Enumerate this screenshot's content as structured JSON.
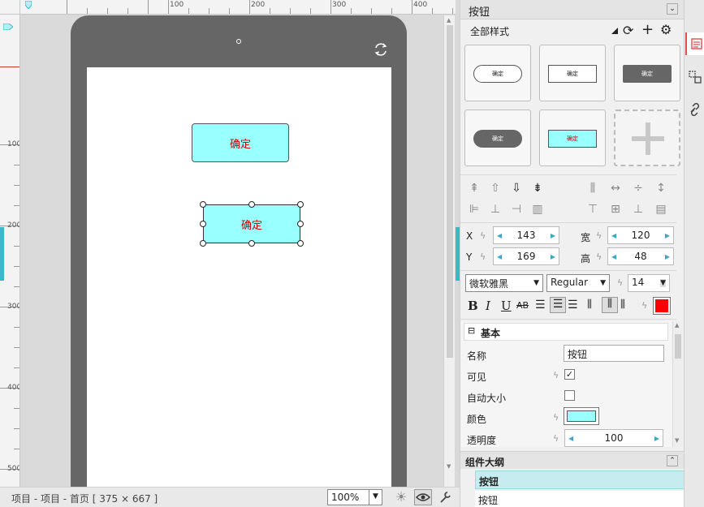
{
  "rulers": {
    "top_labels": [
      "100",
      "200",
      "300",
      "400"
    ],
    "left_labels": [
      "100",
      "200",
      "300",
      "400",
      "500"
    ]
  },
  "canvas": {
    "button1_label": "确定",
    "button2_label": "确定"
  },
  "status": {
    "breadcrumb": "项目 - 项目 - 首页 [ 375 × 667 ]",
    "zoom": "100%"
  },
  "panel": {
    "title": "按钮",
    "styles_filter": "全部样式",
    "style_card_label": "确定",
    "x_label": "X",
    "y_label": "Y",
    "w_label": "宽",
    "h_label": "高",
    "x": "143",
    "y": "169",
    "w": "120",
    "h": "48",
    "font_family": "微软雅黑",
    "font_weight": "Regular",
    "font_size": "14",
    "format": {
      "bold": "B",
      "italic": "I",
      "underline": "U",
      "strike": "AB"
    },
    "text_color": "#ff0000",
    "section_basic": "基本",
    "props": {
      "name_label": "名称",
      "name_value": "按钮",
      "visible_label": "可见",
      "autosize_label": "自动大小",
      "color_label": "颜色",
      "color_value": "#99ffff",
      "opacity_label": "透明度",
      "opacity_value": "100"
    },
    "outline_title": "组件大纲",
    "outline_items": [
      "按钮",
      "按钮"
    ]
  },
  "colors": {
    "accent": "#38b8c9",
    "button_fill": "#99ffff",
    "button_text": "#cc0000",
    "device": "#666666"
  }
}
